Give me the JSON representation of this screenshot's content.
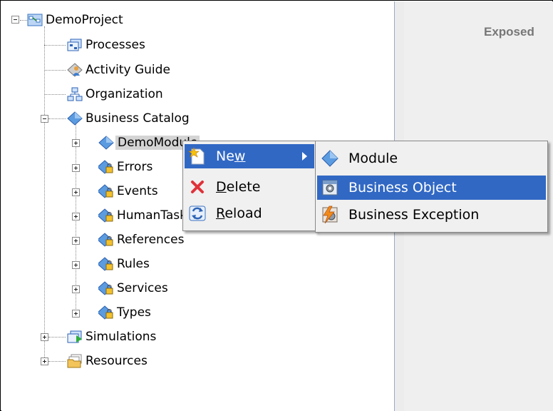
{
  "tree": {
    "root": "DemoProject",
    "items": [
      {
        "label": "Processes"
      },
      {
        "label": "Activity Guide"
      },
      {
        "label": "Organization"
      },
      {
        "label": "Business Catalog"
      }
    ],
    "catalog_children": [
      {
        "label": "DemoModule"
      },
      {
        "label": "Errors"
      },
      {
        "label": "Events"
      },
      {
        "label": "HumanTasks"
      },
      {
        "label": "References"
      },
      {
        "label": "Rules"
      },
      {
        "label": "Services"
      },
      {
        "label": "Types"
      }
    ],
    "bottom": [
      {
        "label": "Simulations"
      },
      {
        "label": "Resources"
      }
    ]
  },
  "context_menu": {
    "new_pre": "Ne",
    "new_mn": "w",
    "delete_mn": "D",
    "delete_rest": "elete",
    "reload_mn": "R",
    "reload_rest": "eload"
  },
  "submenu": {
    "items": [
      {
        "label": "Module"
      },
      {
        "label": "Business Object"
      },
      {
        "label": "Business Exception"
      }
    ]
  },
  "right_panel": {
    "heading": "Exposed"
  },
  "colors": {
    "highlight": "#3168c4",
    "selection_bg": "#d4d4d4",
    "menu_bg": "#f0f0f0"
  }
}
